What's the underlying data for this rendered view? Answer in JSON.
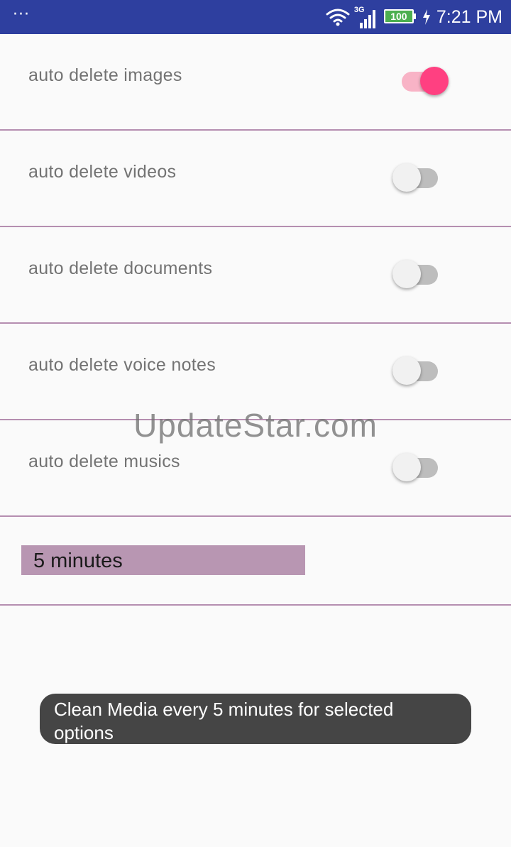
{
  "status_bar": {
    "menu_dots": "···",
    "network_type": "3G",
    "battery_level": "100",
    "time": "7:21 PM",
    "icons": [
      "wifi-icon",
      "signal-icon",
      "battery-icon",
      "charging-icon"
    ]
  },
  "settings": {
    "items": [
      {
        "label": "auto delete images",
        "enabled": true
      },
      {
        "label": "auto delete videos",
        "enabled": false
      },
      {
        "label": "auto delete documents",
        "enabled": false
      },
      {
        "label": "auto delete voice notes",
        "enabled": false
      },
      {
        "label": "auto delete musics",
        "enabled": false
      }
    ],
    "interval": {
      "selected": "5 minutes"
    }
  },
  "watermark": "UpdateStar.com",
  "toast": {
    "message": "Clean Media every 5  minutes for selected options"
  },
  "colors": {
    "status_bar": "#2e3f9f",
    "divider": "#b58eb0",
    "switch_on_thumb": "#ff4081",
    "switch_on_track": "#f8b3c6",
    "switch_off_thumb": "#f1f1f1",
    "switch_off_track": "#bdbdbd",
    "interval_background": "#b896b2",
    "toast_background": "#454545"
  }
}
